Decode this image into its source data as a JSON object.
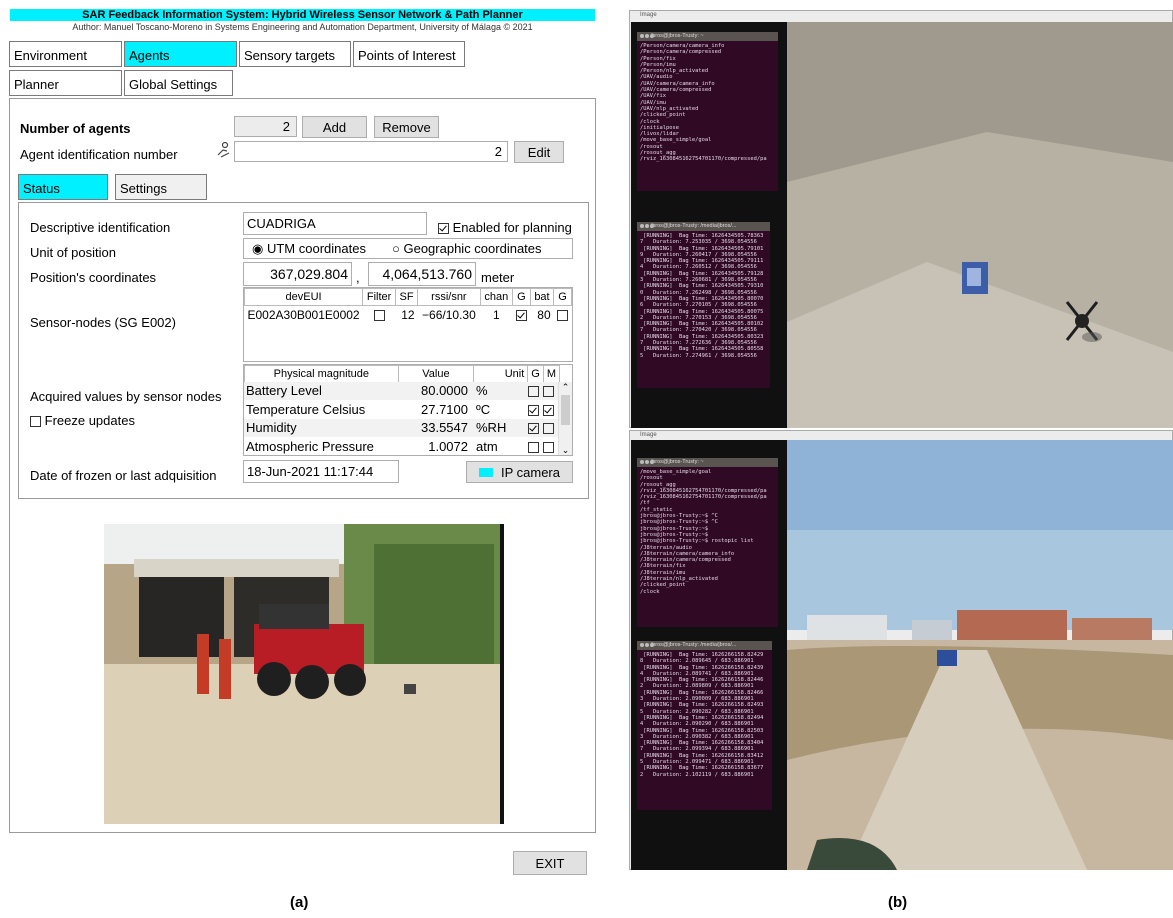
{
  "app": {
    "title": "SAR Feedback Information System: Hybrid Wireless Sensor Network & Path Planner",
    "author": "Author: Manuel Toscano-Moreno in Systems Engineering and Automation Department, University of Málaga   © 2021"
  },
  "tabs": {
    "environment": "Environment",
    "agents": "Agents",
    "sensory_targets": "Sensory targets",
    "points_of_interest": "Points of Interest",
    "planner": "Planner",
    "global_settings": "Global Settings"
  },
  "agents_panel": {
    "number_label": "Number of agents",
    "number_value": "2",
    "add_label": "Add",
    "remove_label": "Remove",
    "id_label": "Agent identification number",
    "id_value": "2",
    "edit_label": "Edit",
    "status_tab": "Status",
    "settings_tab": "Settings"
  },
  "status": {
    "desc_label": "Descriptive identification",
    "desc_value": "CUADRIGA",
    "enabled_label": "Enabled for planning",
    "unit_label": "Unit of position",
    "utm_label": "UTM coordinates",
    "geo_label": "Geographic coordinates",
    "coords_label": "Position's coordinates",
    "coord_x": "367,029.804",
    "coord_sep": ",",
    "coord_y": "4,064,513.760",
    "coord_unit": "meter",
    "sensor_nodes_label": "Sensor-nodes (SG E002)",
    "sensor_cols": [
      "devEUI",
      "Filter",
      "SF",
      "rssi/snr",
      "chan",
      "G",
      "bat",
      "G"
    ],
    "sensor_rows": [
      {
        "deveui": "E002A30B001E0002",
        "sf": "12",
        "rssi": "−66/10.30",
        "chan": "1",
        "bat": "80"
      }
    ],
    "acquired_label": "Acquired values by sensor nodes",
    "freeze_label": "Freeze updates",
    "value_cols": [
      "Physical magnitude",
      "Value",
      "Unit",
      "G",
      "M"
    ],
    "value_rows": [
      {
        "name": "Battery Level",
        "value": "80.0000",
        "unit": "%",
        "g": false,
        "m": false
      },
      {
        "name": "Temperature Celsius",
        "value": "27.7100",
        "unit": "ºC",
        "g": true,
        "m": true
      },
      {
        "name": "Humidity",
        "value": "33.5547",
        "unit": "%RH",
        "g": true,
        "m": false
      },
      {
        "name": "Atmospheric Pressure",
        "value": "1.0072",
        "unit": "atm",
        "g": false,
        "m": false
      }
    ],
    "date_label": "Date of frozen or last adquisition",
    "date_value": "18-Jun-2021 11:17:44",
    "ip_camera_label": "IP camera"
  },
  "exit_label": "EXIT",
  "captions": {
    "a": "(a)",
    "b": "(b)"
  },
  "window_title": "Image",
  "terminal_top_title": "jbros@jbros-Trusty: ~",
  "terminal_top_lines": [
    "/Person/camera/camera_info",
    "/Person/camera/compressed",
    "/Person/fix",
    "/Person/imu",
    "/Person/nlp_activated",
    "/UAV/audio",
    "/UAV/camera/camera_info",
    "/UAV/camera/compressed",
    "/UAV/fix",
    "/UAV/imu",
    "/UAV/nlp_activated",
    "/clicked_point",
    "/clock",
    "/initialpose",
    "/livox/lidar",
    "/move_base_simple/goal",
    "/rosout",
    "/rosout_agg",
    "/rviz_1630845162754701170/compressed/pa"
  ],
  "terminal_top2_title": "jbros@jbros-Trusty: /media/jbros/...",
  "terminal_top2_lines": [
    " [RUNNING]  Bag Time: 1626434505.78363",
    "7   Duration: 7.253035 / 3698.054556",
    " [RUNNING]  Bag Time: 1626434505.79101",
    "9   Duration: 7.260417 / 3698.054556",
    " [RUNNING]  Bag Time: 1626434505.79111",
    "4   Duration: 7.260512 / 3698.054556",
    " [RUNNING]  Bag Time: 1626434505.79128",
    "3   Duration: 7.260681 / 3698.054556",
    " [RUNNING]  Bag Time: 1626434505.79310",
    "0   Duration: 7.262498 / 3698.054556",
    " [RUNNING]  Bag Time: 1626434505.80070",
    "6   Duration: 7.270105 / 3698.054556",
    " [RUNNING]  Bag Time: 1626434505.80075",
    "2   Duration: 7.270153 / 3698.054556",
    " [RUNNING]  Bag Time: 1626434505.80102",
    "7   Duration: 7.270420 / 3698.054556",
    " [RUNNING]  Bag Time: 1626434505.80323",
    "7   Duration: 7.272636 / 3698.054556",
    " [RUNNING]  Bag Time: 1626434505.80558",
    "5   Duration: 7.274961 / 3698.054556"
  ],
  "terminal_bottom_title": "jbros@jbros-Trusty: ~",
  "terminal_bottom_lines": [
    "/move_base_simple/goal",
    "/rosout",
    "/rosout_agg",
    "/rviz_1630845162754701170/compressed/pa",
    "/rviz_1630845162754701170/compressed/pa",
    "/tf",
    "/tf_static",
    "jbros@jbros-Trusty:~$ ^C",
    "jbros@jbros-Trusty:~$ ^C",
    "jbros@jbros-Trusty:~$",
    "jbros@jbros-Trusty:~$",
    "jbros@jbros-Trusty:~$ rostopic list",
    "/J8terrain/audio",
    "/J8terrain/camera/camera_info",
    "/J8terrain/camera/compressed",
    "/J8terrain/fix",
    "/J8terrain/imu",
    "/J8terrain/nlp_activated",
    "/clicked_point",
    "/clock"
  ],
  "terminal_bottom2_title": "jbros@jbros-Trusty: /media/jbros/...",
  "terminal_bottom2_lines": [
    " [RUNNING]  Bag Time: 1626266158.82429",
    "8   Duration: 2.089645 / 683.886901",
    " [RUNNING]  Bag Time: 1626266158.82439",
    "4   Duration: 2.089741 / 683.886901",
    " [RUNNING]  Bag Time: 1626266158.82446",
    "2   Duration: 2.089809 / 683.886901",
    " [RUNNING]  Bag Time: 1626266158.82466",
    "3   Duration: 2.090009 / 683.886901",
    " [RUNNING]  Bag Time: 1626266158.82493",
    "5   Duration: 2.090282 / 683.886901",
    " [RUNNING]  Bag Time: 1626266158.82494",
    "4   Duration: 2.090290 / 683.886901",
    " [RUNNING]  Bag Time: 1626266158.82503",
    "3   Duration: 2.090382 / 683.886901",
    " [RUNNING]  Bag Time: 1626266158.83404",
    "7   Duration: 2.099394 / 683.886901",
    " [RUNNING]  Bag Time: 1626266158.83412",
    "5   Duration: 2.099471 / 683.886901",
    " [RUNNING]  Bag Time: 1626266158.83677",
    "2   Duration: 2.102119 / 683.886901"
  ],
  "colors": {
    "accent": "#00f0ff",
    "terminal_bg": "#300a24"
  }
}
